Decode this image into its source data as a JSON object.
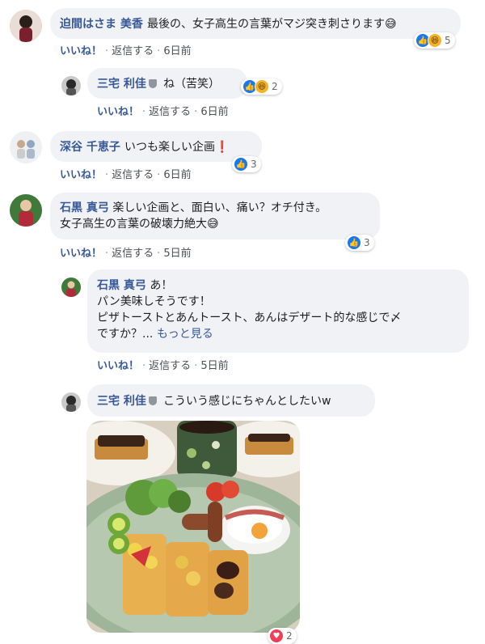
{
  "comments": [
    {
      "author": "迫間はさま 美香",
      "text": "最後の、女子高生の言葉がマジ突き刺さります😅",
      "like_label": "いいね！",
      "reply_label": "返信する",
      "time": "6日前",
      "reaction_count": "5",
      "reactions": [
        "like-icon",
        "haha-icon"
      ]
    },
    {
      "author": "三宅 利佳",
      "text": "ね（苦笑）",
      "like_label": "いいね！",
      "reply_label": "返信する",
      "time": "6日前",
      "reaction_count": "2",
      "reactions": [
        "like-icon",
        "haha-icon"
      ]
    },
    {
      "author": "深谷 千恵子",
      "text": "いつも楽しい企画❗",
      "like_label": "いいね！",
      "reply_label": "返信する",
      "time": "6日前",
      "reaction_count": "3",
      "reactions": [
        "like-icon"
      ]
    },
    {
      "author": "石黒 真弓",
      "text_line1": "楽しい企画と、面白い、痛い？オチ付き。",
      "text_line2": "女子高生の言葉の破壊力絶大😅",
      "like_label": "いいね！",
      "reply_label": "返信する",
      "time": "5日前",
      "reaction_count": "3",
      "reactions": [
        "like-icon"
      ]
    },
    {
      "author": "石黒 真弓",
      "text_line1": "あ！",
      "text_line2": "パン美味しそうです！",
      "text_line3": "ピザトーストとあんトースト、あんはデザート的な感じで〆",
      "text_line4": "ですか？...",
      "see_more": "もっと見る",
      "like_label": "いいね！",
      "reply_label": "返信する",
      "time": "5日前"
    },
    {
      "author": "三宅 利佳",
      "text": "こういう感じにちゃんとしたいw",
      "reaction_count": "2",
      "reactions": [
        "heart-icon"
      ]
    }
  ],
  "colors": {
    "name": "#365899",
    "bubble": "#f0f2f5",
    "like_blue": "#1877f2",
    "haha_yellow": "#f7b125",
    "heart_red": "#f33e58"
  }
}
